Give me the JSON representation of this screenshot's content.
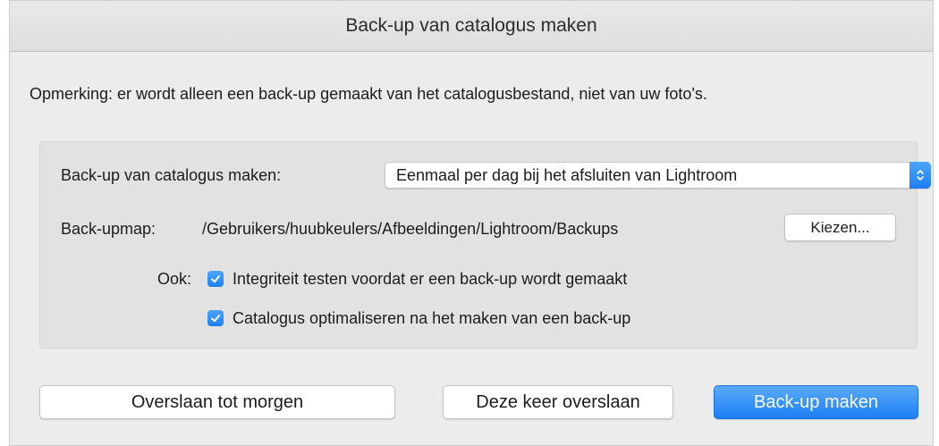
{
  "window": {
    "title": "Back-up van catalogus maken"
  },
  "note": "Opmerking: er wordt alleen een back-up gemaakt van het catalogusbestand, niet van uw foto's.",
  "settings": {
    "frequency_label": "Back-up van catalogus maken:",
    "frequency_value": "Eenmaal per dag bij het afsluiten van Lightroom",
    "folder_label": "Back-upmap:",
    "folder_path": "/Gebruikers/huubkeulers/Afbeeldingen/Lightroom/Backups",
    "choose_label": "Kiezen...",
    "also_label": "Ook:",
    "options": [
      {
        "label": "Integriteit testen voordat er een back-up wordt gemaakt",
        "checked": true
      },
      {
        "label": "Catalogus optimaliseren na het maken van een back-up",
        "checked": true
      }
    ]
  },
  "buttons": {
    "skip_until_tomorrow": "Overslaan tot morgen",
    "skip_this_time": "Deze keer overslaan",
    "backup": "Back-up maken"
  },
  "colors": {
    "accent": "#1c7ef2",
    "window_bg": "#ececec",
    "panel_bg": "#e2e2e2"
  },
  "icons": {
    "popup_arrows": "updown-chevron-icon",
    "checkmark": "checkmark-icon"
  }
}
